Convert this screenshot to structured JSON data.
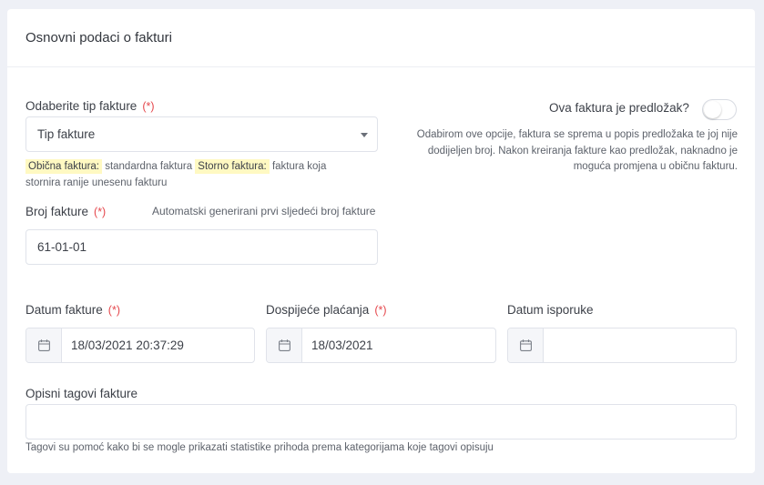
{
  "card": {
    "title": "Osnovni podaci o fakturi"
  },
  "invoice_type": {
    "label": "Odaberite tip fakture",
    "required_mark": "(*)",
    "value": "Tip fakture",
    "hint_regular_tag": "Obična faktura:",
    "hint_regular_text": "standardna faktura",
    "hint_storno_tag": "Storno faktura:",
    "hint_storno_text": "faktura koja",
    "hint_storno_text_2": "stornira ranije unesenu fakturu"
  },
  "template": {
    "label": "Ova faktura je predložak?",
    "enabled": false,
    "description": "Odabirom ove opcije, faktura se sprema u popis predložaka te joj nije dodijeljen broj. Nakon kreiranja fakture kao predložak, naknadno je moguća promjena u običnu fakturu."
  },
  "invoice_number": {
    "label": "Broj fakture",
    "required_mark": "(*)",
    "auto_hint": "Automatski generirani prvi sljedeći broj fakture",
    "value": "61-01-01"
  },
  "invoice_date": {
    "label": "Datum fakture",
    "required_mark": "(*)",
    "value": "18/03/2021 20:37:29"
  },
  "due_date": {
    "label": "Dospijeće plaćanja",
    "required_mark": "(*)",
    "value": "18/03/2021"
  },
  "delivery_date": {
    "label": "Datum isporuke",
    "value": ""
  },
  "tags": {
    "label": "Opisni tagovi fakture",
    "value": "",
    "hint": "Tagovi su pomoć kako bi se mogle prikazati statistike prihoda prema kategorijama koje tagovi opisuju"
  }
}
